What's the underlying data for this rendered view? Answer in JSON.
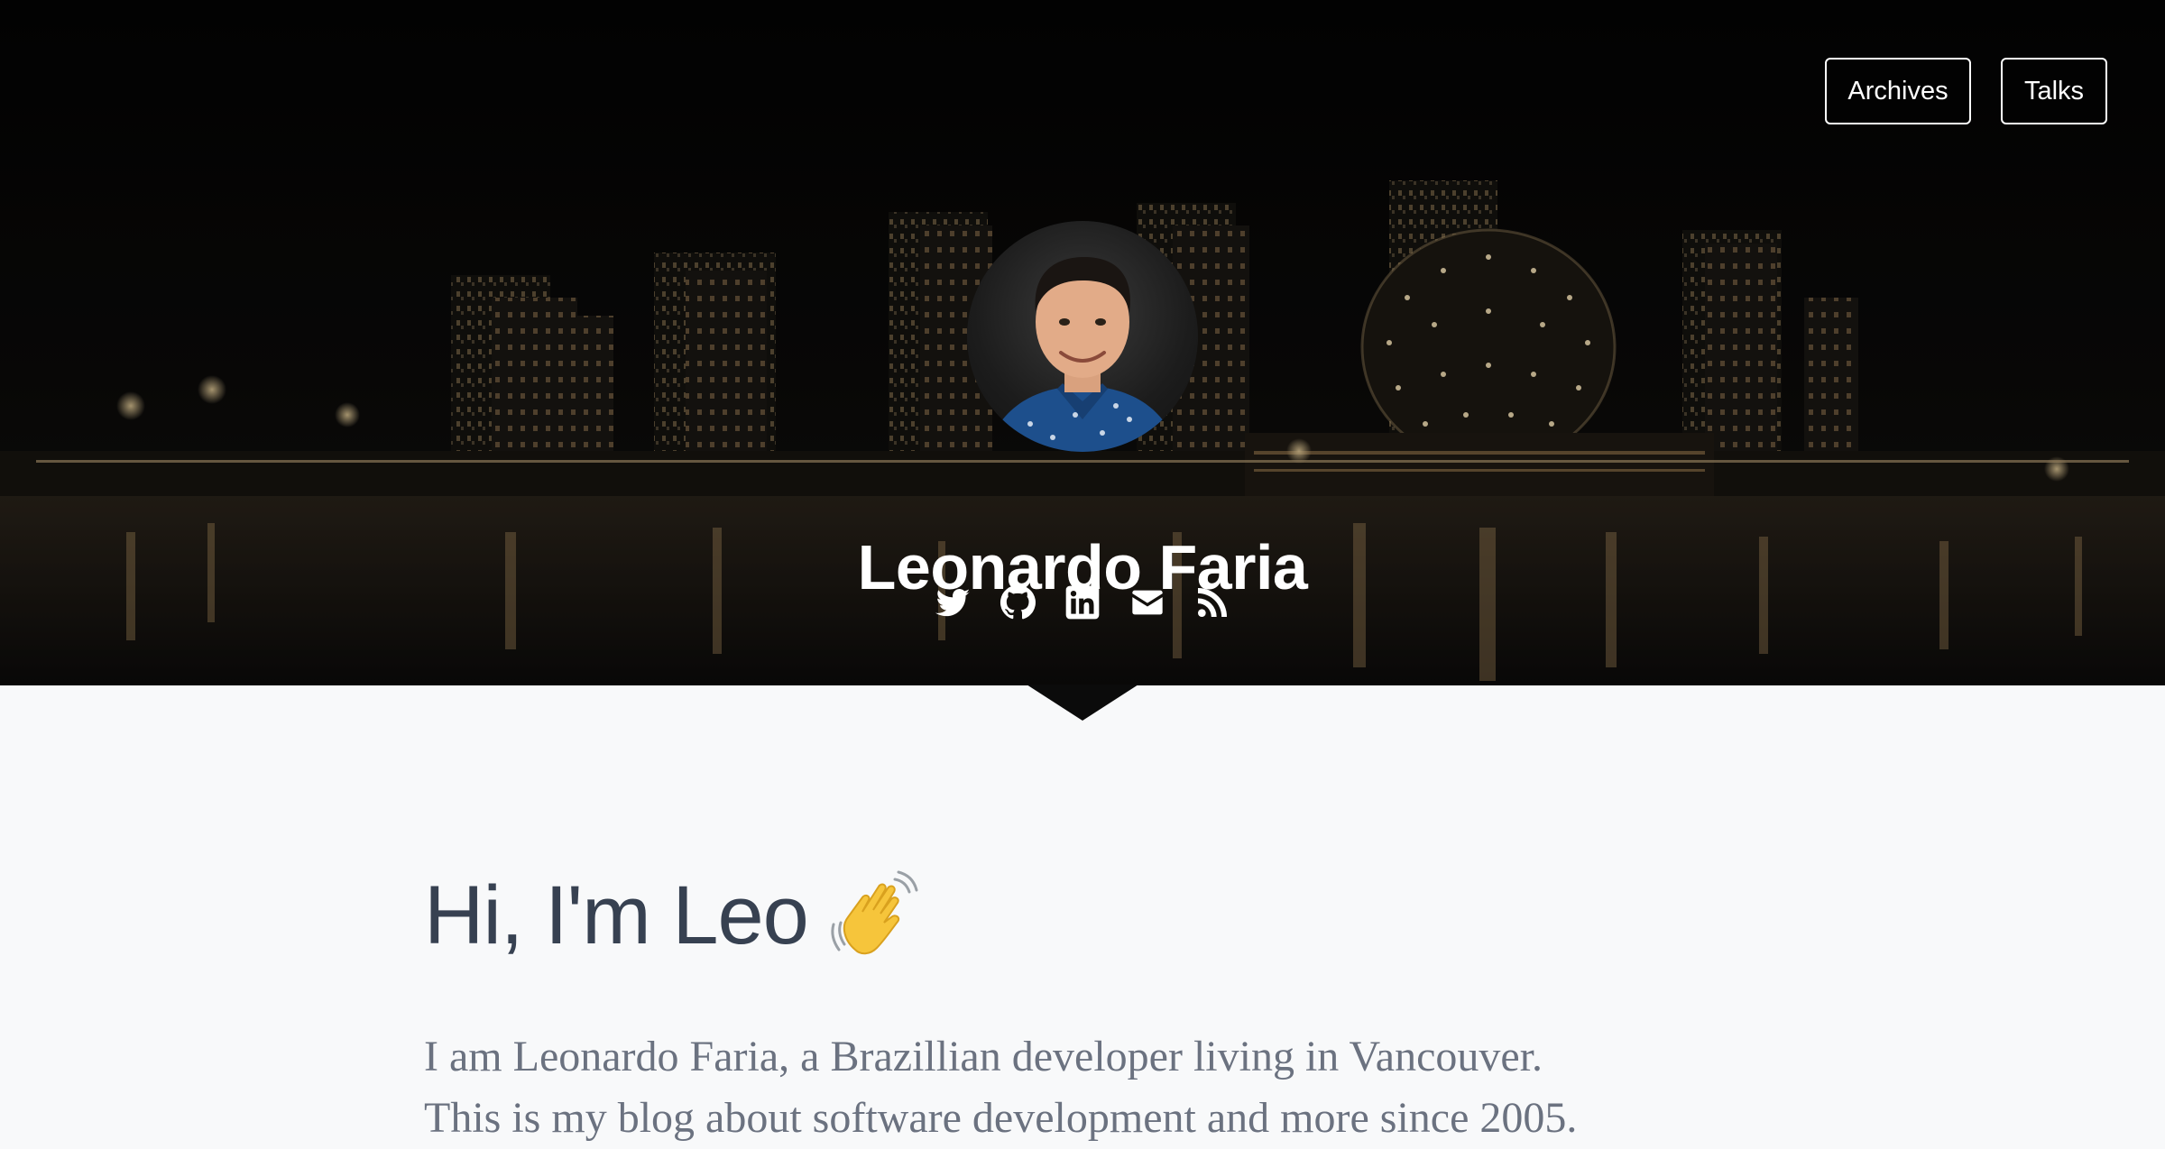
{
  "nav": {
    "archives_label": "Archives",
    "talks_label": "Talks"
  },
  "hero": {
    "name": "Leonardo Faria",
    "social_icons": [
      "twitter-icon",
      "github-icon",
      "linkedin-icon",
      "envelope-icon",
      "rss-icon"
    ]
  },
  "main": {
    "greeting": "Hi, I'm Leo",
    "greeting_emoji": "waving-hand-icon",
    "intro_line_1": "I am Leonardo Faria, a Brazillian developer living in Vancouver.",
    "intro_line_2": "This is my blog about software development and more since 2005."
  },
  "colors": {
    "hero_background": "#050505",
    "page_background": "#f8f9fa",
    "heading": "#374151",
    "body_text": "#6b7280",
    "city_lights": "#e8c98f"
  }
}
